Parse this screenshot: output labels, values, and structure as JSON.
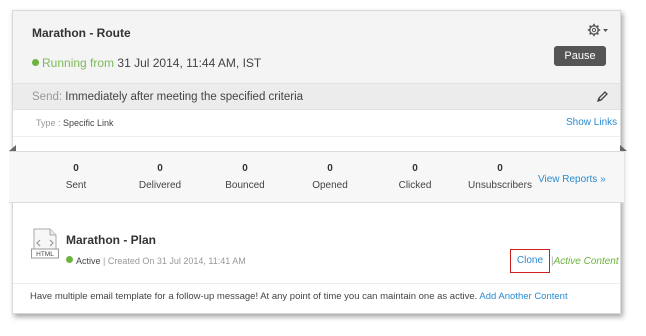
{
  "campaign": {
    "title": "Marathon - Route",
    "running_label": "Running from",
    "running_value": "31 Jul 2014, 11:44 AM, IST",
    "pause_label": "Pause"
  },
  "send": {
    "label": "Send:",
    "value": "Immediately after  meeting the specified criteria"
  },
  "type": {
    "label": "Type :",
    "value": "Specific Link",
    "show_links": "Show Links"
  },
  "stats": {
    "items": [
      {
        "value": "0",
        "label": "Sent"
      },
      {
        "value": "0",
        "label": "Delivered"
      },
      {
        "value": "0",
        "label": "Bounced"
      },
      {
        "value": "0",
        "label": "Opened"
      },
      {
        "value": "0",
        "label": "Clicked"
      },
      {
        "value": "0",
        "label": "Unsubscribers"
      }
    ],
    "view_reports": "View Reports »"
  },
  "content": {
    "icon_label": "HTML",
    "title": "Marathon - Plan",
    "status": "Active",
    "created": "| Created On 31 Jul 2014, 11:41 AM",
    "clone_label": "Clone",
    "separator": "|",
    "active_content": "Active Content"
  },
  "footer": {
    "note": "Have multiple email template for a follow-up message! At any point of time you can maintain one as active.",
    "add_link": "Add Another Content"
  },
  "colors": {
    "accent_link": "#2a8bd0",
    "status_green": "#6cb33f",
    "pause_button": "#555555",
    "highlight_red": "#cc1f1f"
  }
}
